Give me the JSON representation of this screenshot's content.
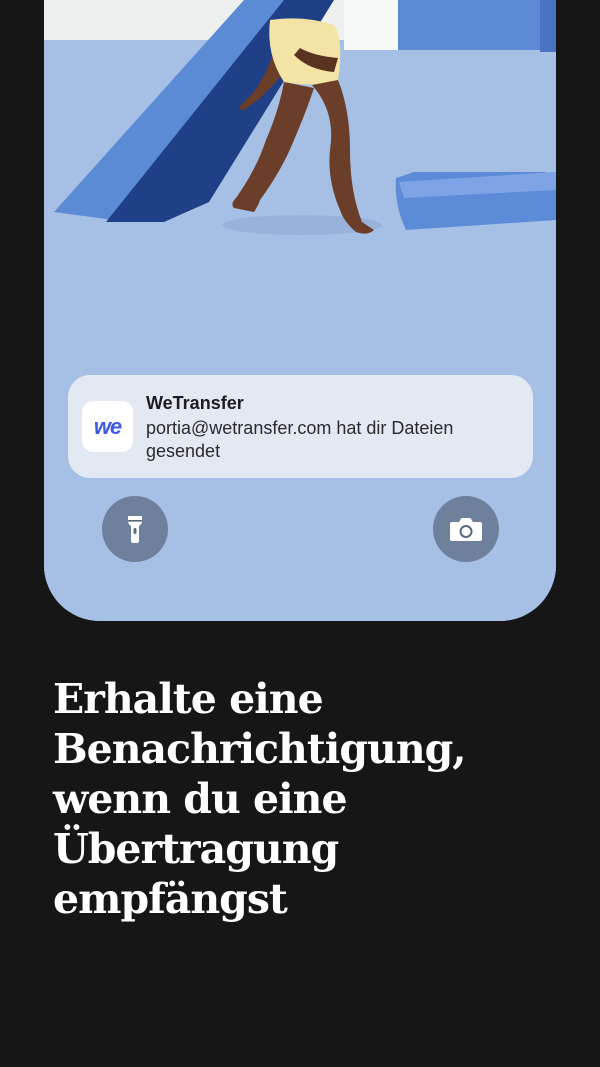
{
  "notification": {
    "app_name": "WeTransfer",
    "app_icon_text": "we",
    "message": "portia@wetransfer.com hat dir Dateien gesendet"
  },
  "lockscreen": {
    "left_button_icon": "flashlight-icon",
    "right_button_icon": "camera-icon"
  },
  "headline": "Erhalte eine Benachrichtigung, wenn du eine Übertragung empfängst",
  "colors": {
    "background": "#161616",
    "wallpaper_blue": "#a3bce2",
    "brand_blue": "#3c5ae6"
  }
}
